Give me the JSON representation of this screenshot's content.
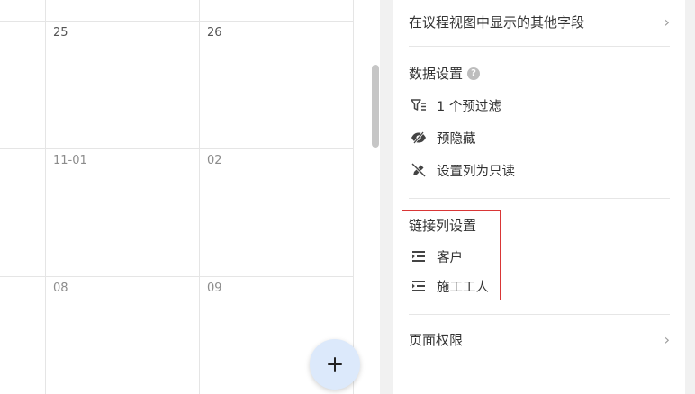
{
  "calendar": {
    "rows": [
      [
        "",
        "",
        ""
      ],
      [
        "",
        "25",
        "26"
      ],
      [
        "",
        "11-01",
        "02"
      ],
      [
        "",
        "08",
        "09"
      ]
    ],
    "add_icon": "plus-icon"
  },
  "panel": {
    "agenda_fields_label": "在议程视图中显示的其他字段",
    "data_settings": {
      "title": "数据设置",
      "help_icon": "?",
      "items": [
        {
          "icon": "filter-icon",
          "label": "1 个预过滤"
        },
        {
          "icon": "eye-off-icon",
          "label": "预隐藏"
        },
        {
          "icon": "pen-off-icon",
          "label": "设置列为只读"
        }
      ]
    },
    "link_settings": {
      "title": "链接列设置",
      "items": [
        {
          "icon": "linked-list-icon",
          "label": "客户"
        },
        {
          "icon": "linked-list-icon",
          "label": "施工工人"
        }
      ]
    },
    "page_permissions_label": "页面权限",
    "chevron": "›"
  },
  "colors": {
    "fab_bg": "#dce9fb",
    "highlight_border": "#d93636",
    "divider_bg": "#f1f1f1"
  }
}
